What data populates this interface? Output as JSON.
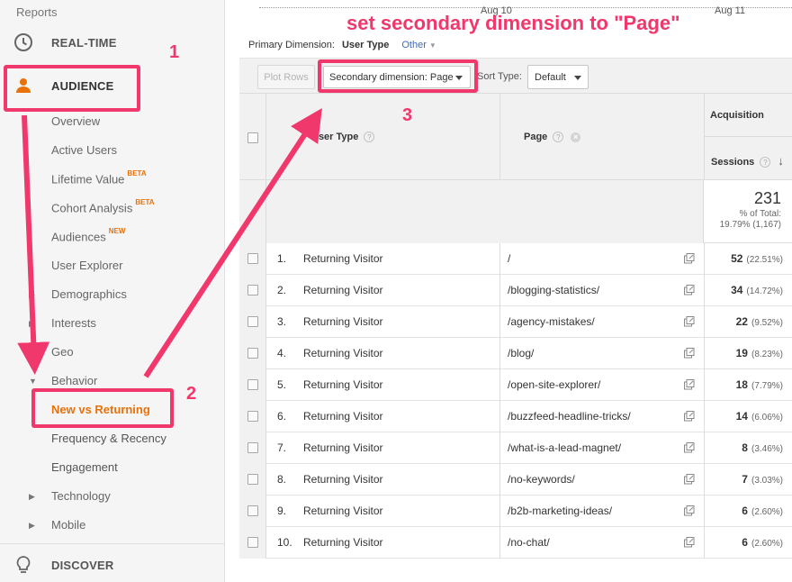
{
  "sidebar": {
    "reports_label": "Reports",
    "realtime_label": "REAL-TIME",
    "audience_label": "AUDIENCE",
    "discover_label": "DISCOVER",
    "items": [
      {
        "label": "Overview",
        "badge": ""
      },
      {
        "label": "Active Users",
        "badge": ""
      },
      {
        "label": "Lifetime Value",
        "badge": "BETA"
      },
      {
        "label": "Cohort Analysis",
        "badge": "BETA"
      },
      {
        "label": "Audiences",
        "badge": "NEW"
      },
      {
        "label": "User Explorer",
        "badge": ""
      },
      {
        "label": "Demographics",
        "badge": ""
      },
      {
        "label": "Interests",
        "badge": ""
      },
      {
        "label": "Geo",
        "badge": ""
      },
      {
        "label": "Behavior",
        "badge": ""
      },
      {
        "label": "New vs Returning",
        "badge": ""
      },
      {
        "label": "Frequency & Recency",
        "badge": ""
      },
      {
        "label": "Engagement",
        "badge": ""
      },
      {
        "label": "Technology",
        "badge": ""
      },
      {
        "label": "Mobile",
        "badge": ""
      }
    ]
  },
  "axis": {
    "date1": "Aug 10",
    "date2": "Aug 11"
  },
  "dimension": {
    "primary_label": "Primary Dimension:",
    "primary_value": "User Type",
    "other_label": "Other"
  },
  "toolbar": {
    "plot_rows": "Plot Rows",
    "secondary_dimension": "Secondary dimension: Page",
    "sort_type_label": "Sort Type:",
    "sort_type_value": "Default"
  },
  "table": {
    "col_user_type": "User Type",
    "col_page": "Page",
    "group_acquisition": "Acquisition",
    "col_sessions": "Sessions",
    "total_sessions": "231",
    "total_pct_label": "% of Total:",
    "total_pct_value": "19.79% (1,167)",
    "rows": [
      {
        "idx": "1.",
        "user_type": "Returning Visitor",
        "page": "/",
        "sessions": "52",
        "pct": "(22.51%)"
      },
      {
        "idx": "2.",
        "user_type": "Returning Visitor",
        "page": "/blogging-statistics/",
        "sessions": "34",
        "pct": "(14.72%)"
      },
      {
        "idx": "3.",
        "user_type": "Returning Visitor",
        "page": "/agency-mistakes/",
        "sessions": "22",
        "pct": "(9.52%)"
      },
      {
        "idx": "4.",
        "user_type": "Returning Visitor",
        "page": "/blog/",
        "sessions": "19",
        "pct": "(8.23%)"
      },
      {
        "idx": "5.",
        "user_type": "Returning Visitor",
        "page": "/open-site-explorer/",
        "sessions": "18",
        "pct": "(7.79%)"
      },
      {
        "idx": "6.",
        "user_type": "Returning Visitor",
        "page": "/buzzfeed-headline-tricks/",
        "sessions": "14",
        "pct": "(6.06%)"
      },
      {
        "idx": "7.",
        "user_type": "Returning Visitor",
        "page": "/what-is-a-lead-magnet/",
        "sessions": "8",
        "pct": "(3.46%)"
      },
      {
        "idx": "8.",
        "user_type": "Returning Visitor",
        "page": "/no-keywords/",
        "sessions": "7",
        "pct": "(3.03%)"
      },
      {
        "idx": "9.",
        "user_type": "Returning Visitor",
        "page": "/b2b-marketing-ideas/",
        "sessions": "6",
        "pct": "(2.60%)"
      },
      {
        "idx": "10.",
        "user_type": "Returning Visitor",
        "page": "/no-chat/",
        "sessions": "6",
        "pct": "(2.60%)"
      }
    ]
  },
  "annotations": {
    "title": "set secondary dimension to \"Page\"",
    "step1": "1",
    "step2": "2",
    "step3": "3",
    "color": "#f1386d"
  },
  "colors": {
    "accent_orange": "#e8710a",
    "link_blue": "#3a6cc0"
  }
}
